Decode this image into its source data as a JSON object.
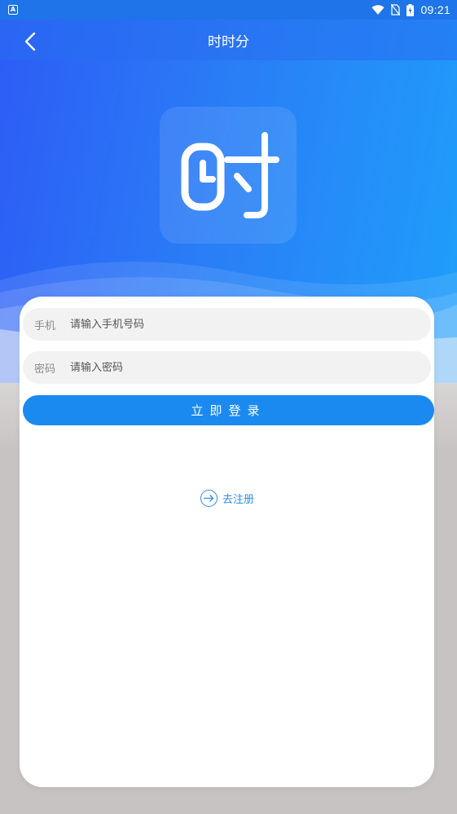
{
  "status_bar": {
    "notification_icon": "A",
    "time": "09:21",
    "icons": [
      "wifi-icon",
      "no-sim-icon",
      "battery-charging-icon"
    ]
  },
  "nav": {
    "title": "时时分",
    "back_icon": "chevron-left-icon"
  },
  "logo": {
    "glyph": "时"
  },
  "form": {
    "phone_label": "手机",
    "phone_placeholder": "请输入手机号码",
    "phone_value": "",
    "password_label": "密码",
    "password_placeholder": "请输入密码",
    "password_value": "",
    "login_label": "立即登录"
  },
  "register": {
    "label": "去注册",
    "icon": "arrow-right-circle-icon"
  },
  "colors": {
    "header_gradient_start": "#2d5cf6",
    "header_gradient_end": "#1ea0fb",
    "primary_button": "#1a8af0",
    "link": "#2f8de6",
    "background": "#c9c4c4"
  }
}
